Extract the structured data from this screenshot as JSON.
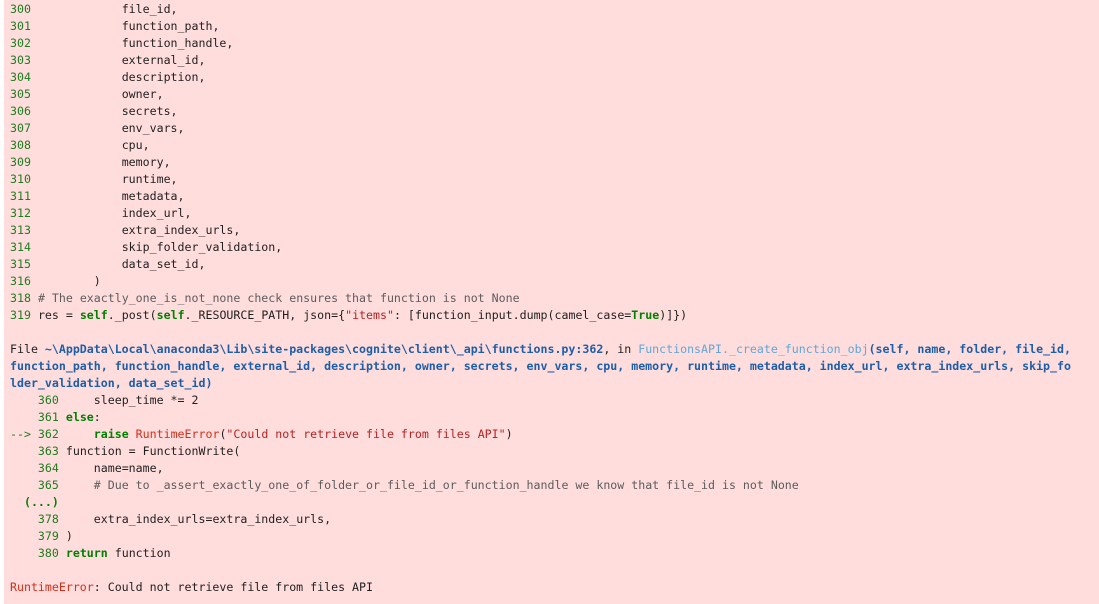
{
  "top_frame": {
    "lines": [
      {
        "num": "300",
        "code": "        file_id,"
      },
      {
        "num": "301",
        "code": "        function_path,"
      },
      {
        "num": "302",
        "code": "        function_handle,"
      },
      {
        "num": "303",
        "code": "        external_id,"
      },
      {
        "num": "304",
        "code": "        description,"
      },
      {
        "num": "305",
        "code": "        owner,"
      },
      {
        "num": "306",
        "code": "        secrets,"
      },
      {
        "num": "307",
        "code": "        env_vars,"
      },
      {
        "num": "308",
        "code": "        cpu,"
      },
      {
        "num": "309",
        "code": "        memory,"
      },
      {
        "num": "310",
        "code": "        runtime,"
      },
      {
        "num": "311",
        "code": "        metadata,"
      },
      {
        "num": "312",
        "code": "        index_url,"
      },
      {
        "num": "313",
        "code": "        extra_index_urls,"
      },
      {
        "num": "314",
        "code": "        skip_folder_validation,"
      },
      {
        "num": "315",
        "code": "        data_set_id,"
      },
      {
        "num": "316",
        "code": "    )"
      }
    ],
    "line_318": {
      "num": "318",
      "code": "# The exactly_one_is_not_none check ensures that function is not None"
    },
    "line_319": {
      "num": "319",
      "p1": "res = ",
      "p2": "self",
      "p3": "._post(",
      "p4": "self",
      "p5": "._RESOURCE_PATH, json={",
      "p6": "\"items\"",
      "p7": ": [function_input.dump(camel_case=",
      "p8": "True",
      "p9": ")]})"
    }
  },
  "file_header": {
    "file_word": "File ",
    "path": "~\\AppData\\Local\\anaconda3\\Lib\\site-packages\\cognite\\client\\_api\\functions.py:362",
    "in_word": ", in ",
    "func_name": "FunctionsAPI._create_function_obj",
    "args_line1": "(self, name, folder, file_id,",
    "args_line2": "function_path, function_handle, external_id, description, owner, secrets, env_vars, cpu, memory, runtime, metadata, index_url, extra_index_urls, skip_fo",
    "args_line3": "lder_validation, data_set_id)"
  },
  "frame": {
    "l360": {
      "num": "360",
      "code": "    sleep_time *= 2"
    },
    "l361": {
      "num": "361",
      "kw": "else",
      "rest": ":"
    },
    "l362": {
      "arrow": "--> 362",
      "indent": "    ",
      "kw": "raise",
      "sp": " ",
      "exc": "RuntimeError",
      "p1": "(",
      "str": "\"Could not retrieve file from files API\"",
      "p2": ")"
    },
    "l363": {
      "num": "363",
      "code": "function = FunctionWrite("
    },
    "l364": {
      "num": "364",
      "code": "    name=name,"
    },
    "l365": {
      "num": "365",
      "indent": "    ",
      "comment": "# Due to _assert_exactly_one_of_folder_or_file_id_or_function_handle we know that file_id is not None"
    },
    "ellipsis": "(...)",
    "l378": {
      "num": "378",
      "code": "    extra_index_urls=extra_index_urls,"
    },
    "l379": {
      "num": "379",
      "code": ")"
    },
    "l380": {
      "num": "380",
      "kw": "return",
      "rest": " function"
    }
  },
  "error": {
    "type": "RuntimeError",
    "message": ": Could not retrieve file from files API"
  },
  "colors": {
    "background": "#ffdddd",
    "line_number": "#1e7d1e",
    "keyword": "#008000",
    "string": "#ba2121",
    "exception": "#d12f1b",
    "file_header": "#1c5fa8"
  }
}
